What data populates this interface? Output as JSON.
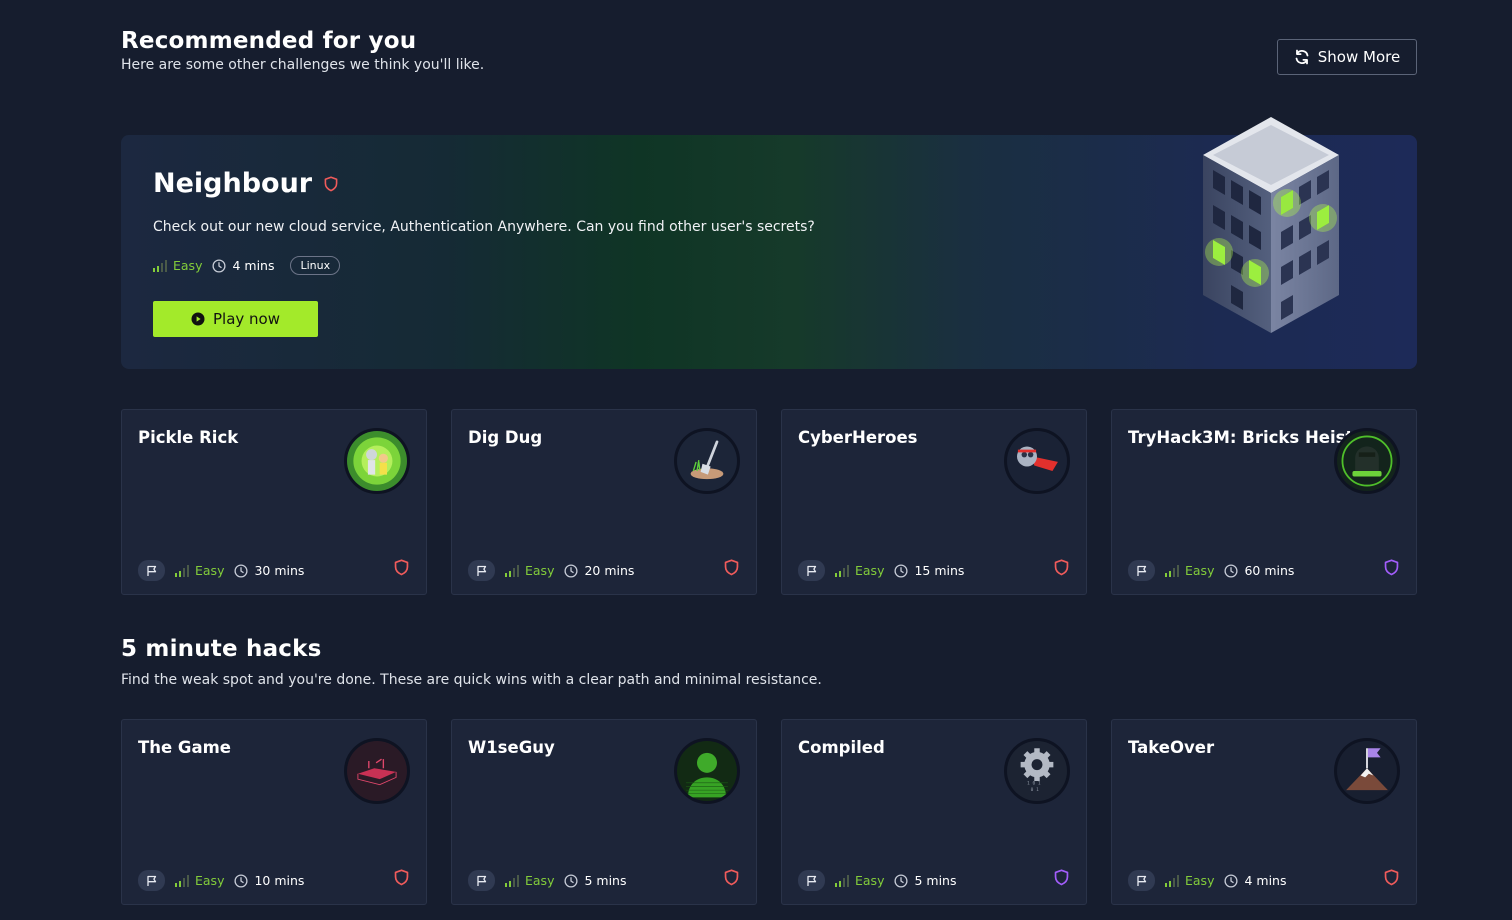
{
  "recommended": {
    "title": "Recommended for you",
    "subtitle": "Here are some other challenges we think you'll like.",
    "show_more_label": "Show More"
  },
  "hero": {
    "title": "Neighbour",
    "description": "Check out our new cloud service, Authentication Anywhere. Can you find other user's secrets?",
    "difficulty": "Easy",
    "duration": "4 mins",
    "tag": "Linux",
    "play_label": "Play now"
  },
  "row1": [
    {
      "title": "Pickle Rick",
      "difficulty": "Easy",
      "duration": "30 mins",
      "shield_color": "#ef5b5b",
      "icon": "pickle-rick-thumbnail"
    },
    {
      "title": "Dig Dug",
      "difficulty": "Easy",
      "duration": "20 mins",
      "shield_color": "#ef5b5b",
      "icon": "shovel-thumbnail"
    },
    {
      "title": "CyberHeroes",
      "difficulty": "Easy",
      "duration": "15 mins",
      "shield_color": "#ef5b5b",
      "icon": "flying-hero-thumbnail"
    },
    {
      "title": "TryHack3M: Bricks Heist",
      "difficulty": "Easy",
      "duration": "60 mins",
      "shield_color": "#a25dfa",
      "icon": "hacker-thumbnail"
    }
  ],
  "five_minute": {
    "title": "5 minute hacks",
    "subtitle": "Find the weak spot and you're done. These are quick wins with a clear path and minimal resistance."
  },
  "row2": [
    {
      "title": "The Game",
      "difficulty": "Easy",
      "duration": "10 mins",
      "shield_color": "#ef5b5b",
      "icon": "game-thumbnail"
    },
    {
      "title": "W1seGuy",
      "difficulty": "Easy",
      "duration": "5 mins",
      "shield_color": "#ef5b5b",
      "icon": "silhouette-thumbnail"
    },
    {
      "title": "Compiled",
      "difficulty": "Easy",
      "duration": "5 mins",
      "shield_color": "#a25dfa",
      "icon": "gear-thumbnail"
    },
    {
      "title": "TakeOver",
      "difficulty": "Easy",
      "duration": "4 mins",
      "shield_color": "#ef5b5b",
      "icon": "mountain-flag-thumbnail"
    }
  ],
  "colors": {
    "background": "#161d2e",
    "card": "#1d2539",
    "accent_green": "#a3ea2a",
    "easy_green": "#82cc3a"
  }
}
